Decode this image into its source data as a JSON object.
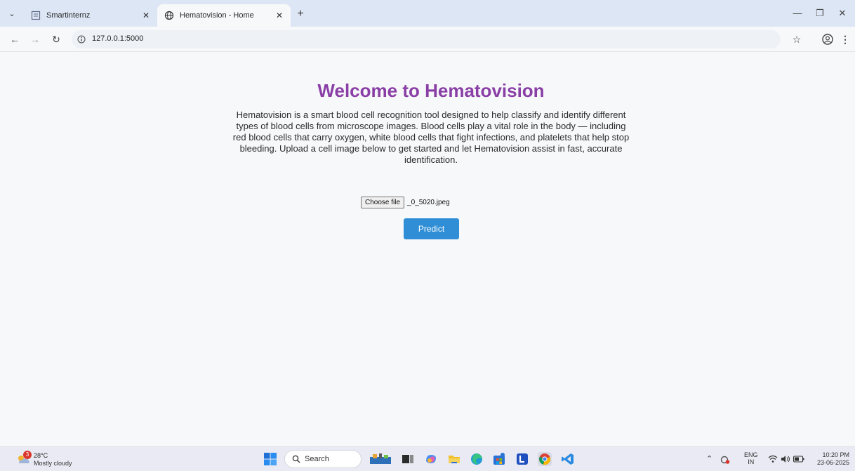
{
  "browser": {
    "tabs": [
      {
        "title": "Smartinternz",
        "active": false
      },
      {
        "title": "Hematovision - Home",
        "active": true
      }
    ],
    "url": "127.0.0.1:5000"
  },
  "page": {
    "title": "Welcome to Hematovision",
    "description": "Hematovision is a smart blood cell recognition tool designed to help classify and identify different types of blood cells from microscope images. Blood cells play a vital role in the body — including red blood cells that carry oxygen, white blood cells that fight infections, and platelets that help stop bleeding. Upload a cell image below to get started and let Hematovision assist in fast, accurate identification.",
    "file_input": {
      "button_label": "Choose file",
      "file_name": "_0_5020.jpeg"
    },
    "predict_label": "Predict"
  },
  "taskbar": {
    "weather": {
      "temperature": "28°C",
      "condition": "Mostly cloudy",
      "badge": "3"
    },
    "search_label": "Search",
    "language": {
      "line1": "ENG",
      "line2": "IN"
    },
    "clock": {
      "time": "10:20 PM",
      "date": "23-06-2025"
    }
  },
  "colors": {
    "title": "#8a3fa6",
    "predict_button": "#2f8ed6",
    "tabstrip": "#dde6f5",
    "page_background": "#f7f8fa"
  }
}
